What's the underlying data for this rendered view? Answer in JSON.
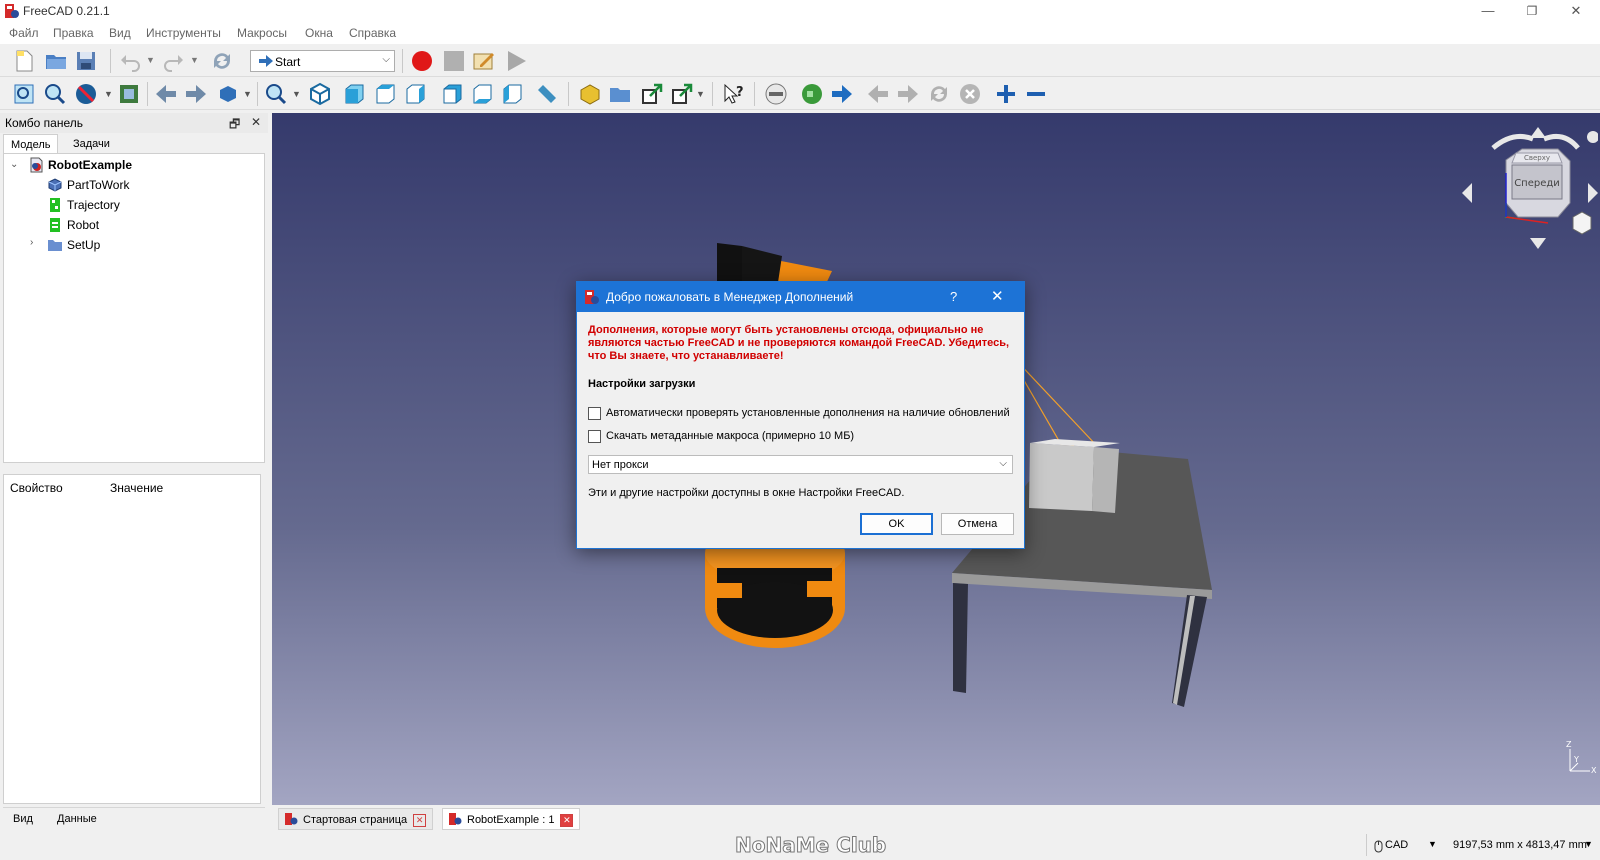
{
  "window": {
    "title": "FreeCAD 0.21.1",
    "minimize_glyph": "—",
    "restore_glyph": "❐",
    "close_glyph": "✕"
  },
  "menu": [
    "Файл",
    "Правка",
    "Вид",
    "Инструменты",
    "Макросы",
    "Окна",
    "Справка"
  ],
  "toolbar": {
    "workbench": "Start",
    "macro_icons": [
      "record-macro-icon",
      "stop-macro-icon",
      "edit-macro-icon",
      "run-macro-icon"
    ]
  },
  "combo_panel": {
    "title": "Комбо панель",
    "float_glyph": "🗗",
    "close_glyph": "✕",
    "tabs": [
      "Модель",
      "Задачи"
    ],
    "tree": [
      {
        "label": "RobotExample",
        "bold": true
      },
      {
        "label": "PartToWork"
      },
      {
        "label": "Trajectory"
      },
      {
        "label": "Robot"
      },
      {
        "label": "SetUp"
      }
    ],
    "property_columns": [
      "Свойство",
      "Значение"
    ],
    "bottom_tabs": [
      "Вид",
      "Данные"
    ]
  },
  "navcube": {
    "top_face": "Сверху",
    "front_face": "Спереди"
  },
  "axis_labels": {
    "z": "Z",
    "y": "Y",
    "x": "X"
  },
  "document_tabs": [
    {
      "label": "Стартовая страница",
      "active": false
    },
    {
      "label": "RobotExample : 1",
      "active": true
    }
  ],
  "statusbar": {
    "watermark": "NoNaMe Club",
    "nav_style": "CAD",
    "dimensions": "9197,53 mm x 4813,47 mm"
  },
  "dialog": {
    "title": "Добро пожаловать в Менеджер Дополнений",
    "help_glyph": "?",
    "close_glyph": "✕",
    "warning": "Дополнения, которые могут быть установлены отсюда, официально не являются частью FreeCAD и не проверяются командой FreeCAD. Убедитесь, что Вы знаете, что устанавливаете!",
    "section": "Настройки загрузки",
    "check_updates": {
      "label": "Автоматически проверять установленные дополнения на наличие обновлений",
      "checked": false
    },
    "download_macro_metadata": {
      "label": "Скачать метаданные макроса (примерно 10 МБ)",
      "checked": false
    },
    "proxy": "Нет прокси",
    "note": "Эти и другие настройки доступны в окне Настройки FreeCAD.",
    "ok_label": "OK",
    "cancel_label": "Отмена"
  },
  "colors": {
    "dialog_title_bg": "#1d73d6",
    "warning_text": "#d10000",
    "viewport_top": "#353a6c",
    "viewport_bottom": "#a3a5c2",
    "robot_orange": "#f08a10"
  }
}
